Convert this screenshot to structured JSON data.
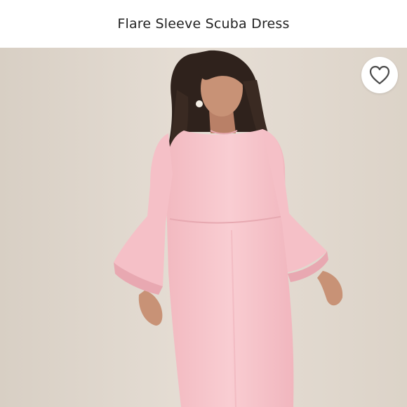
{
  "product": {
    "title": "Flare Sleeve Scuba Dress"
  },
  "colors": {
    "backdrop": "#e3dbd2",
    "dress": "#f7c6cc",
    "skin": "#c89276",
    "hair": "#2f221c"
  },
  "favorite": {
    "icon": "heart-outline-icon"
  }
}
